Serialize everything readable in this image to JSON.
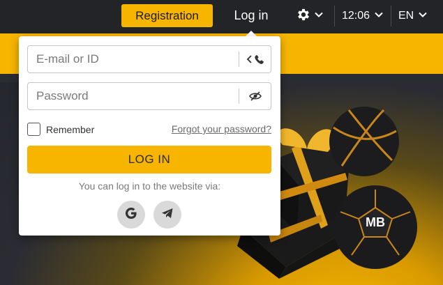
{
  "header": {
    "registration_label": "Registration",
    "login_label": "Log in",
    "settings_icon": "gear-icon",
    "time": "12:06",
    "language": "EN"
  },
  "login_form": {
    "id_placeholder": "E-mail or ID",
    "id_addon_icon": "phone-switch-icon",
    "password_placeholder": "Password",
    "password_addon_icon": "eye-off-icon",
    "remember_label": "Remember",
    "forgot_label": "Forgot your password?",
    "submit_label": "LOG IN",
    "via_text": "You can log in to the website via:",
    "social": [
      {
        "name": "google",
        "icon": "google-icon"
      },
      {
        "name": "telegram",
        "icon": "telegram-icon"
      }
    ]
  },
  "hero": {
    "logo_text": "MB"
  },
  "colors": {
    "accent": "#f7b500",
    "topbar": "#232427",
    "popup_bg": "#ffffff"
  }
}
